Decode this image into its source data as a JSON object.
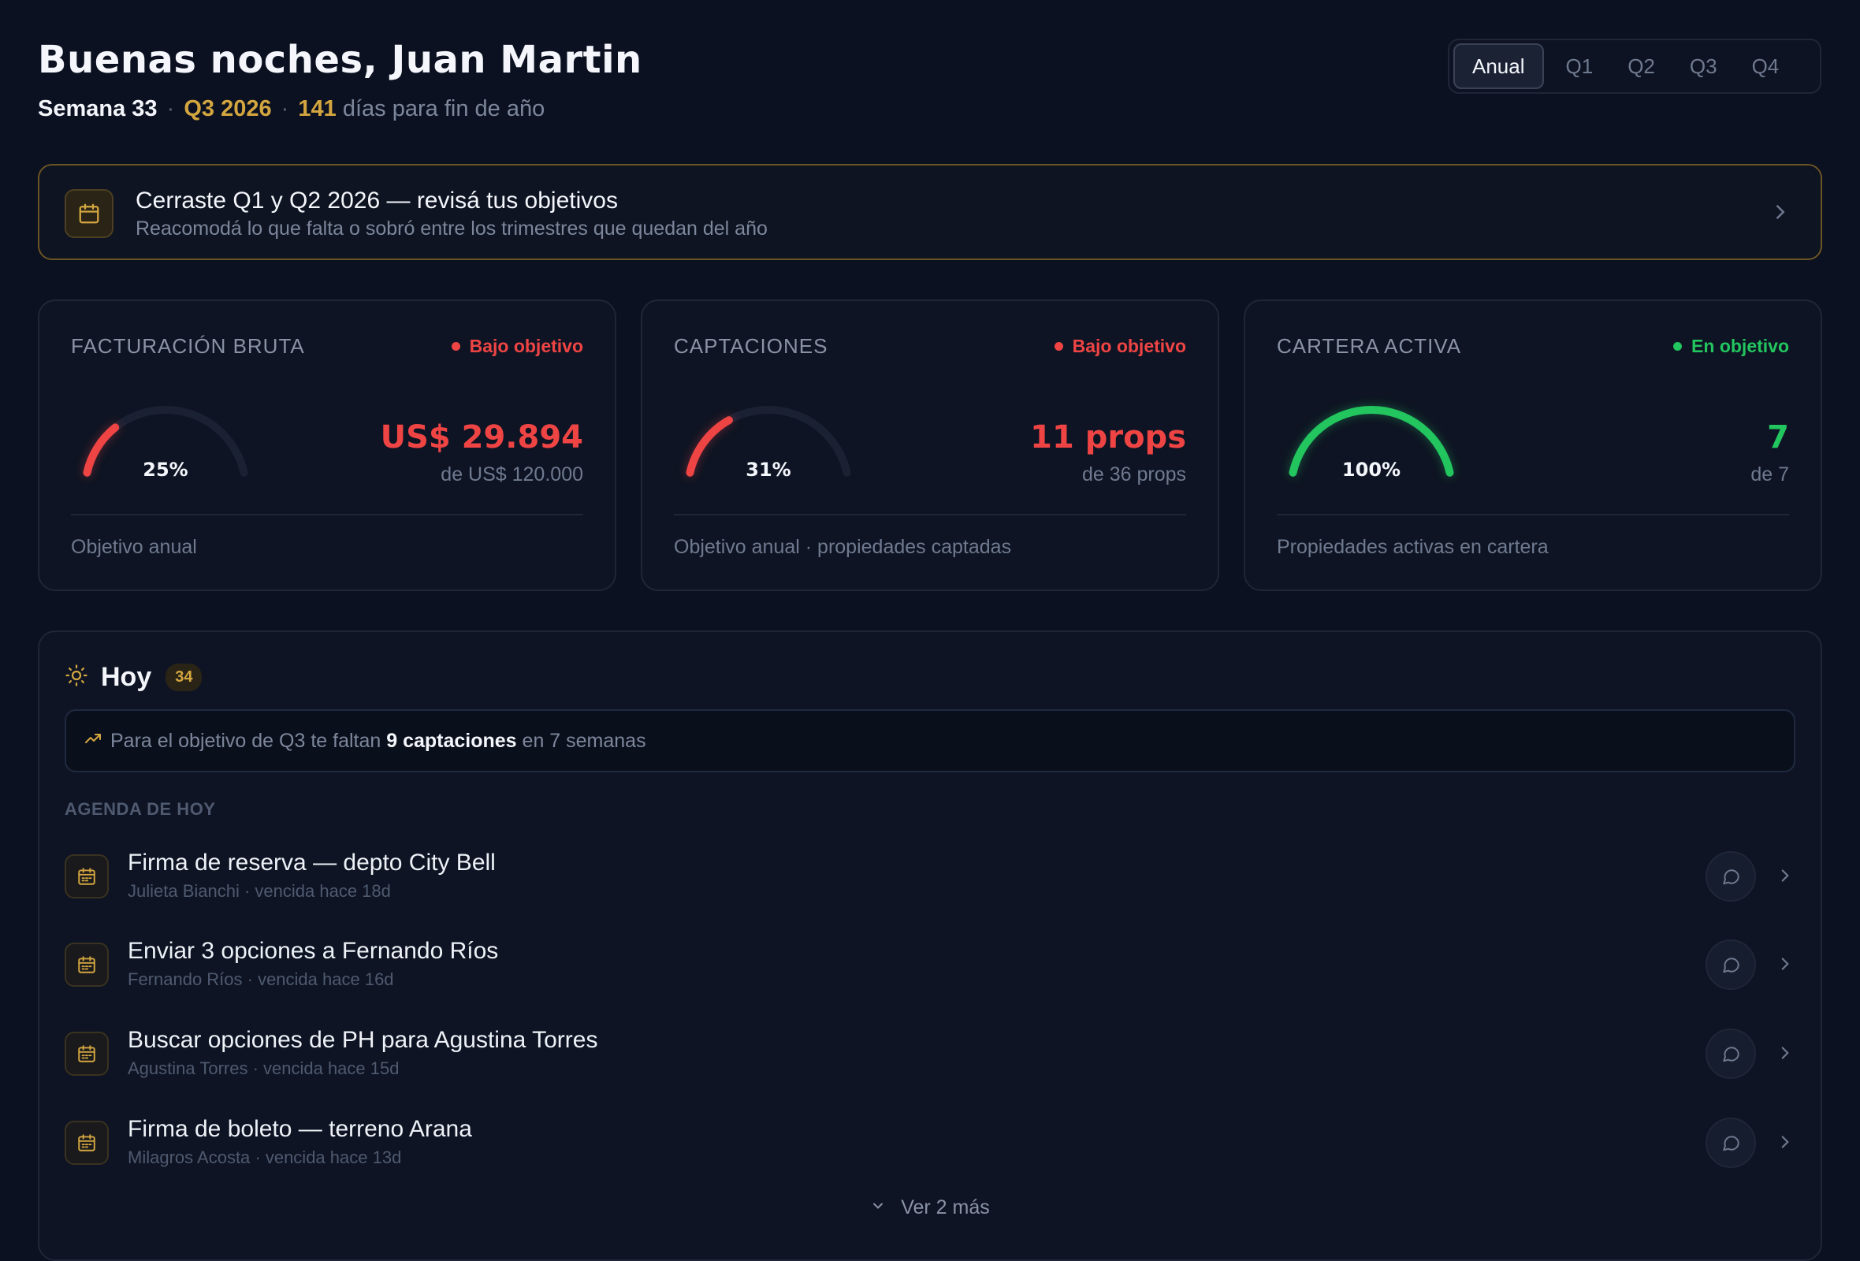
{
  "header": {
    "greeting": "Buenas noches, Juan Martin",
    "week": "Semana 33",
    "quarter": "Q3 2026",
    "days_left": "141",
    "days_left_suffix": "días para fin de año",
    "separator": "·"
  },
  "period_switch": {
    "options": [
      "Anual",
      "Q1",
      "Q2",
      "Q3",
      "Q4"
    ],
    "selected": "Anual"
  },
  "banner": {
    "icon": "calendar-icon",
    "title": "Cerraste Q1 y Q2 2026 — revisá tus objetivos",
    "subtitle": "Reacomodá lo que falta o sobró entre los trimestres que quedan del año"
  },
  "kpis": [
    {
      "label": "FACTURACIÓN BRUTA",
      "status": "Bajo objetivo",
      "status_color": "#ef4444",
      "percent_label": "25%",
      "progress": 0.25,
      "value": "US$ 29.894",
      "of": "de US$ 120.000",
      "footer": "Objetivo anual",
      "color": "#ef4444"
    },
    {
      "label": "CAPTACIONES",
      "status": "Bajo objetivo",
      "status_color": "#ef4444",
      "percent_label": "31%",
      "progress": 0.31,
      "value": "11 props",
      "of": "de 36 props",
      "footer": "Objetivo anual · propiedades captadas",
      "color": "#ef4444"
    },
    {
      "label": "CARTERA ACTIVA",
      "status": "En objetivo",
      "status_color": "#22c55e",
      "percent_label": "100%",
      "progress": 1.0,
      "value": "7",
      "of": "de 7",
      "footer": "Propiedades activas en cartera",
      "color": "#22c55e"
    }
  ],
  "today": {
    "icon": "sun-icon",
    "title": "Hoy",
    "count": "34",
    "goal_prefix": "Para el objetivo de Q3 te faltan",
    "goal_highlight": "9 captaciones",
    "goal_suffix": "en 7 semanas",
    "agenda_label": "AGENDA DE HOY",
    "items": [
      {
        "title": "Firma de reserva — depto City Bell",
        "sub": "Julieta Bianchi · vencida hace 18d"
      },
      {
        "title": "Enviar 3 opciones a Fernando Ríos",
        "sub": "Fernando Ríos · vencida hace 16d"
      },
      {
        "title": "Buscar opciones de PH para Agustina Torres",
        "sub": "Agustina Torres · vencida hace 15d"
      },
      {
        "title": "Firma de boleto — terreno Arana",
        "sub": "Milagros Acosta · vencida hace 13d"
      }
    ],
    "more_label": "Ver 2 más"
  },
  "colors": {
    "accent_gold": "#d4a640",
    "danger": "#ef4444",
    "success": "#22c55e",
    "background": "#0b1120"
  }
}
